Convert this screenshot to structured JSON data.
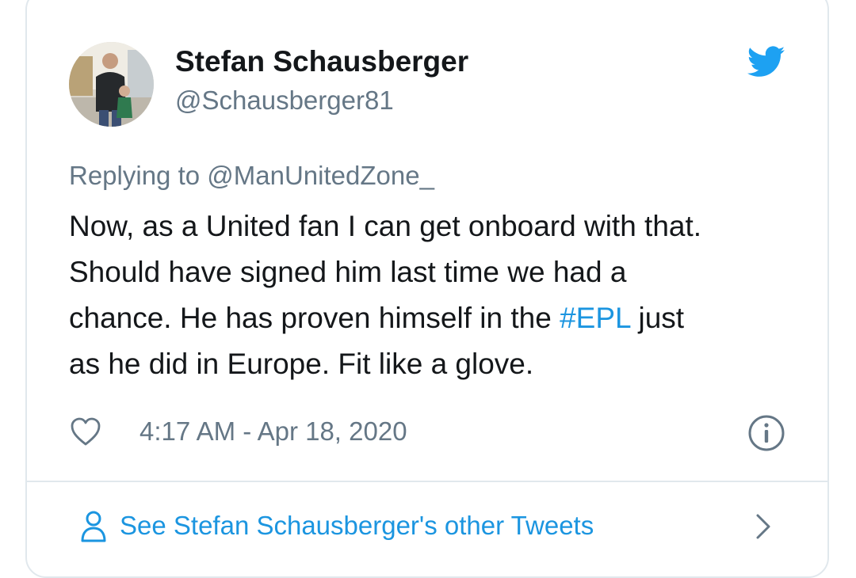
{
  "tweet": {
    "author_name": "Stefan Schausberger",
    "author_handle": "@Schausberger81",
    "replying_to": "Replying to @ManUnitedZone_",
    "text_lines": [
      {
        "before": "Now, as a United fan I can get onboard with that.",
        "hashtag": "",
        "after": ""
      },
      {
        "before": "Should have signed him last time we had a",
        "hashtag": "",
        "after": ""
      },
      {
        "before": "chance. He has proven himself in the ",
        "hashtag": "#EPL",
        "after": " just"
      },
      {
        "before": "as he did in Europe. Fit like a glove.",
        "hashtag": "",
        "after": ""
      }
    ],
    "timestamp": "4:17 AM - Apr 18, 2020"
  },
  "footer": {
    "link_label": "See Stefan Schausberger's other Tweets"
  },
  "icons": {
    "brand": "twitter-bird-icon",
    "like": "heart-icon",
    "info": "info-icon",
    "user": "user-icon",
    "chevron": "chevron-right-icon"
  },
  "colors": {
    "brand_blue": "#1da1f2",
    "link_blue": "#1b95e0",
    "text_primary": "#14171a",
    "text_secondary": "#657786",
    "border": "#e1e8ed"
  }
}
